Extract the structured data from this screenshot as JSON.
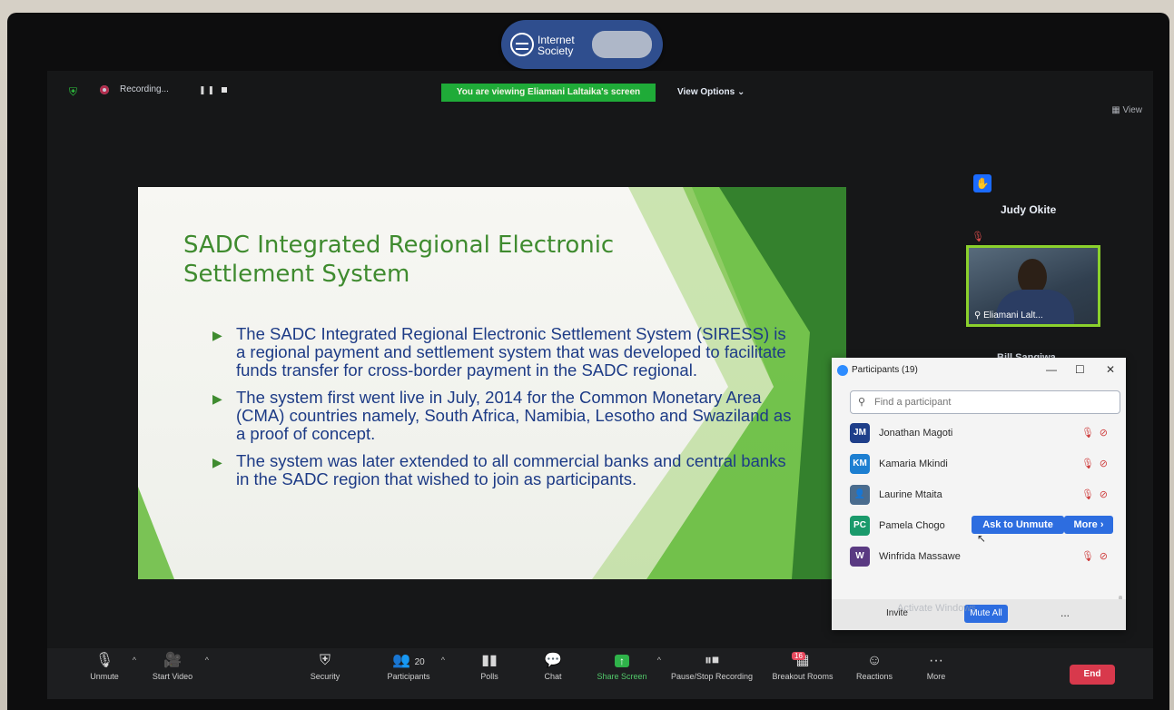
{
  "webcam_cover": {
    "brand": "Internet Society"
  },
  "topbar": {
    "recording_label": "Recording...",
    "viewing_banner": "You are viewing Eliamani Laltaika's screen",
    "view_options": "View Options ⌄",
    "view_button": "View"
  },
  "slide": {
    "title": "SADC Integrated Regional Electronic Settlement System",
    "bullets": [
      "The SADC Integrated Regional Electronic Settlement System (SIRESS) is a regional payment and settlement system that was developed to facilitate funds transfer for cross-border payment in the SADC regional.",
      "The system first went live in July, 2014 for the Common Monetary Area (CMA) countries namely, South Africa, Namibia, Lesotho and Swaziland as a proof of concept.",
      "The system was later extended to all commercial banks and central banks in the SADC region that wished to join as participants."
    ],
    "colors": {
      "title": "#3f8b2f",
      "body": "#1d3b86",
      "accent_green": "#5cb82f"
    }
  },
  "video_panel": {
    "raised_hand_name": "Judy Okite",
    "pinned_video_name": "Eliamani Lalt...",
    "next_name": "Bill Sangiwa"
  },
  "participants": {
    "title": "Participants (19)",
    "search_placeholder": "Find a participant",
    "list": [
      {
        "initials": "JM",
        "name": "Jonathan Magoti",
        "color": "#1f3f8a"
      },
      {
        "initials": "KM",
        "name": "Kamaria Mkindi",
        "color": "#1d7fd1"
      },
      {
        "initials": "",
        "name": "Laurine Mtaita",
        "color": "#4a6c8e"
      },
      {
        "initials": "PC",
        "name": "Pamela Chogo",
        "color": "#1a9a6b"
      },
      {
        "initials": "W",
        "name": "Winfrida Massawe",
        "color": "#5a3a82"
      }
    ],
    "ask_to_unmute": "Ask to Unmute",
    "more": "More ›",
    "invite": "Invite",
    "mute_all": "Mute All",
    "dots": "..."
  },
  "toolbar": {
    "unmute": "Unmute",
    "start_video": "Start Video",
    "security": "Security",
    "participants_count": "20",
    "participants": "Participants",
    "polls": "Polls",
    "chat": "Chat",
    "share_screen": "Share Screen",
    "pause_recording": "Pause/Stop Recording",
    "breakout_count": "16",
    "breakout_rooms": "Breakout Rooms",
    "reactions": "Reactions",
    "more": "More",
    "end": "End"
  },
  "watermark": "Activate Windows"
}
